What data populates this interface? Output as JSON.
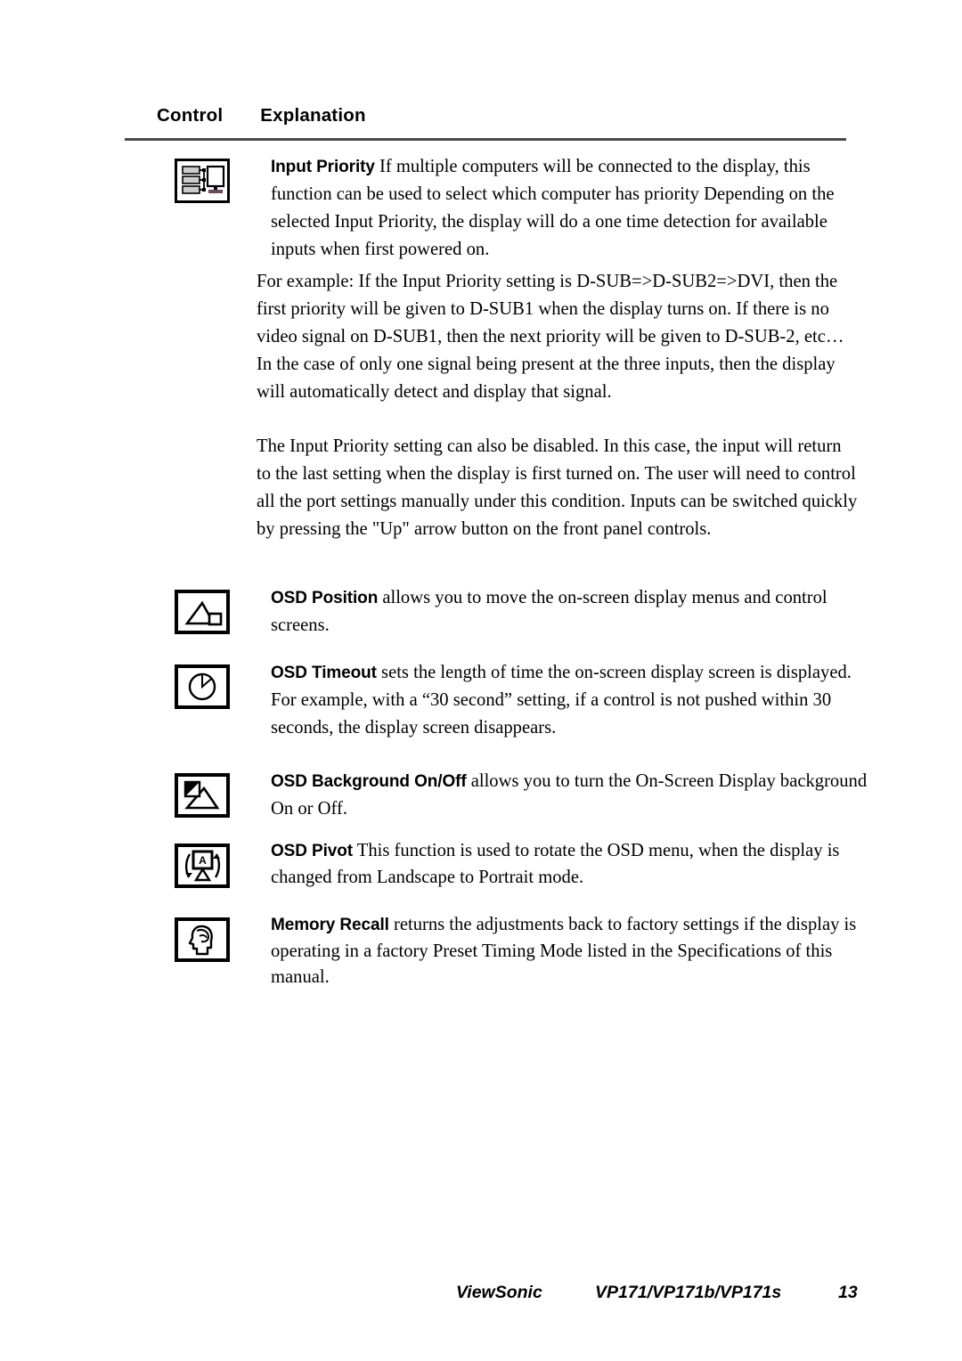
{
  "page": {
    "header": {
      "col_control": "Control",
      "col_explanation": "Explanation"
    },
    "entries": [
      {
        "icon": "input-priority-icon",
        "label": "Input Priority",
        "body": " If multiple computers will be connected to the display, this function can be used to select which computer has priority Depending on the selected Input Priority, the display will do a one time detection for available inputs when first powered on."
      },
      {
        "icon": "osd-position-icon",
        "label": "OSD Position",
        "body": " allows you to move the on-screen display menus and control screens."
      },
      {
        "icon": "osd-timeout-icon",
        "label": "OSD Timeout",
        "body": " sets the length of time the on-screen display screen is displayed. For example, with a “30 second” setting, if a control is not pushed within 30 seconds, the display screen disappears."
      },
      {
        "icon": "osd-background-icon",
        "label": "OSD Background On/Off",
        "body": " allows you to turn the On-Screen Display background On or Off."
      },
      {
        "icon": "osd-pivot-icon",
        "label": "OSD Pivot",
        "body": " This function is used to rotate the OSD menu, when the display is changed from Landscape to Portrait mode."
      },
      {
        "icon": "memory-recall-icon",
        "label": "Memory Recall",
        "body": " returns the adjustments back to factory settings if the display is operating in a factory Preset Timing Mode listed in the Specifications of this manual."
      }
    ],
    "paragraphs": {
      "example": "For example: If the Input Priority setting is D-SUB=>D-SUB2=>DVI, then the first priority will be given to D-SUB1 when the display turns on. If there is no video signal on D-SUB1, then the next priority will be given to D-SUB-2, etc… In the case of only one signal being present at the three inputs, then the display will automatically detect and display that signal.",
      "disable": "The Input Priority setting can also be disabled. In this case, the input will return to the last setting when the display is first turned on. The user will need to control all the port settings manually under this condition. Inputs can be switched quickly by pressing the \"Up\" arrow button on the front panel controls."
    },
    "footer": {
      "brand": "ViewSonic",
      "model": "VP171/VP171b/VP171s",
      "page_number": "13"
    },
    "colors": {
      "text": "#000000",
      "rule": "#4a4a4a",
      "background": "#ffffff"
    }
  }
}
